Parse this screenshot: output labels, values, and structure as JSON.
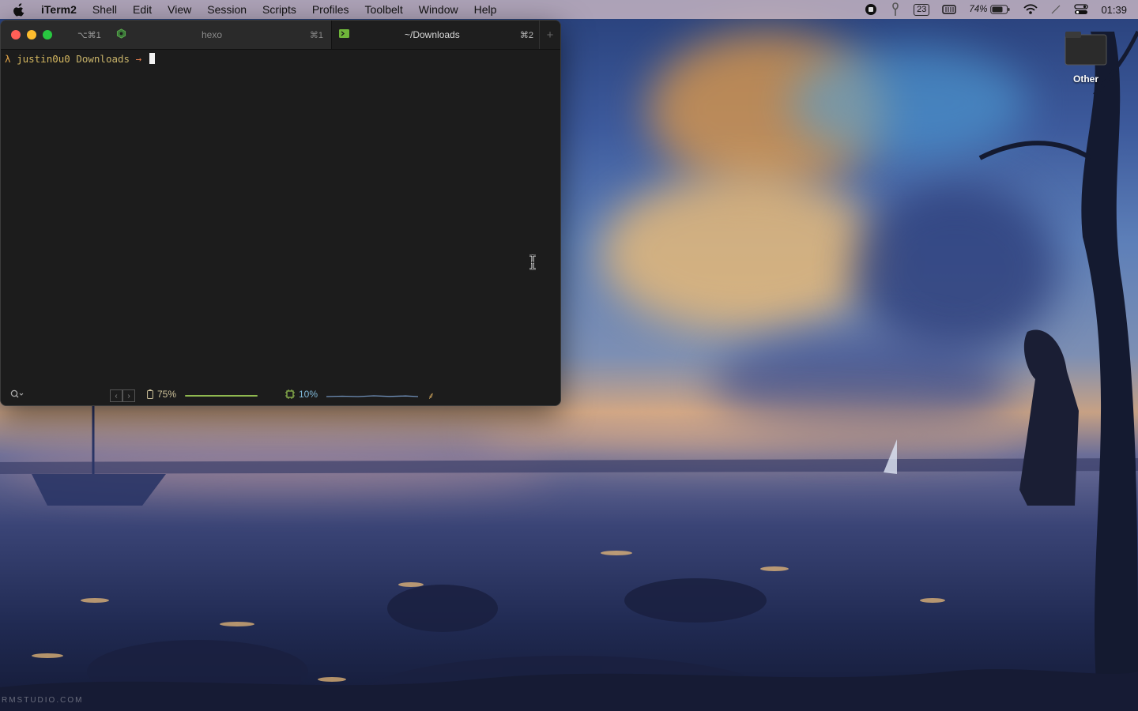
{
  "menubar": {
    "items": [
      "iTerm2",
      "Shell",
      "Edit",
      "View",
      "Session",
      "Scripts",
      "Profiles",
      "Toolbelt",
      "Window",
      "Help"
    ],
    "status": {
      "badge": "23",
      "battery_percent": "74%",
      "clock": "01:39"
    }
  },
  "window": {
    "tabs": [
      {
        "shortcut_left": "⌥⌘1",
        "title": "hexo",
        "shortcut": "⌘1",
        "active": false
      },
      {
        "title": "~/Downloads",
        "shortcut": "⌘2",
        "active": true
      }
    ],
    "new_tab_label": "+",
    "terminal": {
      "prompt_symbol": "λ",
      "user": "justin0u0",
      "cwd": "Downloads",
      "arrow": "→"
    },
    "statusbar": {
      "battery": "75%",
      "battery_level": 0.75,
      "cpu": "10%",
      "cpu_level": 0.1
    }
  },
  "desktop": {
    "icon_label": "Other"
  },
  "watermark": "RMSTUDIO.COM",
  "colors": {
    "accent_prompt": "#d4b760",
    "close": "#ff5f57",
    "minimize": "#febc2e",
    "zoom": "#28c840"
  }
}
